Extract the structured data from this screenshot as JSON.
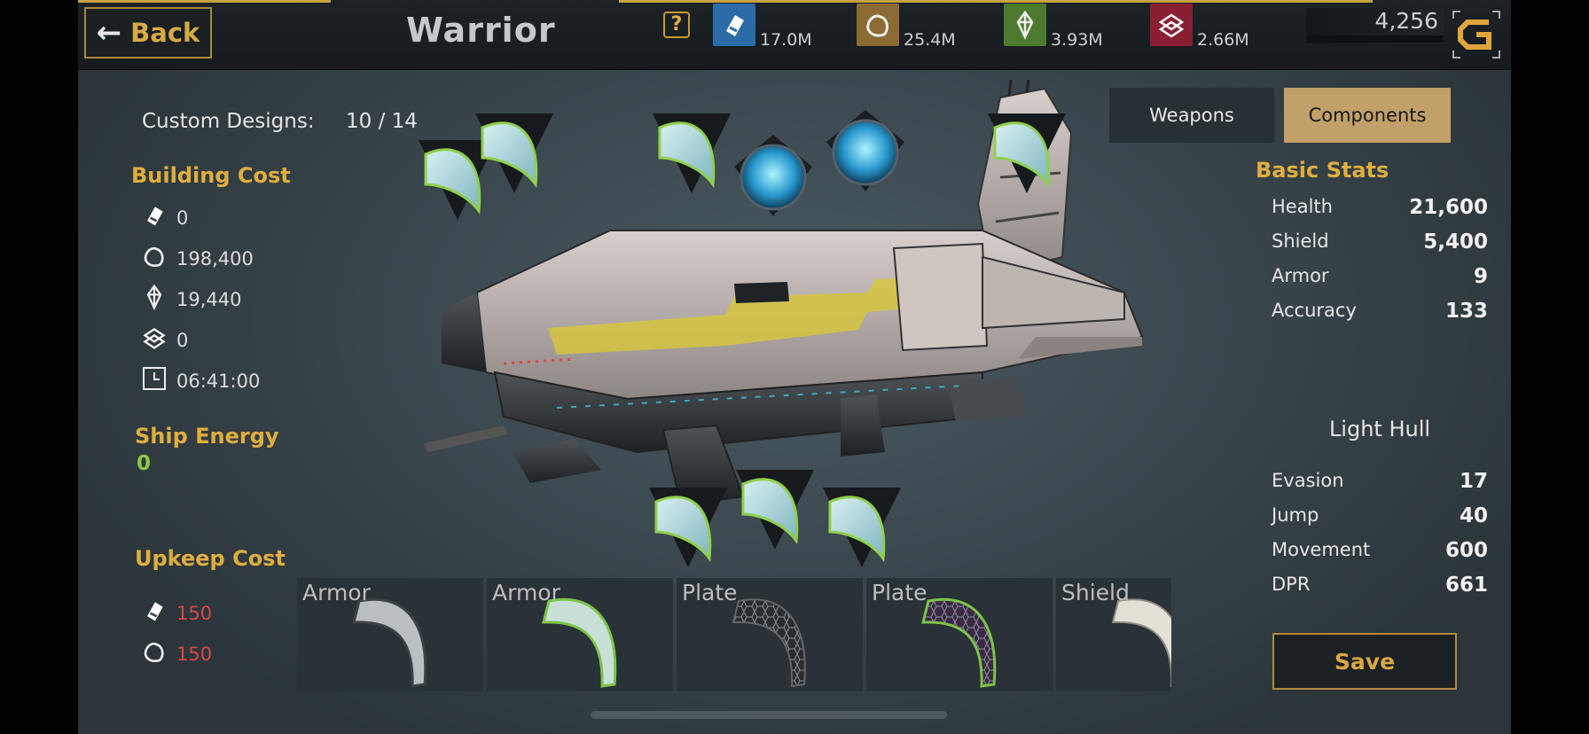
{
  "header": {
    "back_label": "Back",
    "title": "Warrior",
    "help_label": "?",
    "resources": [
      {
        "icon": "credits-icon",
        "value": "17.0M",
        "color": "#2b6ca6"
      },
      {
        "icon": "ore-icon",
        "value": "25.4M",
        "color": "#8b6a34"
      },
      {
        "icon": "crystal-icon",
        "value": "3.93M",
        "color": "#4e7a2f"
      },
      {
        "icon": "alloy-icon",
        "value": "2.66M",
        "color": "#8a1f33"
      }
    ],
    "gold": "4,256"
  },
  "left_panel": {
    "custom_designs_label": "Custom Designs:",
    "custom_designs_value": "10 / 14",
    "building_cost_title": "Building Cost",
    "building_cost": [
      {
        "icon": "credits-icon",
        "value": "0"
      },
      {
        "icon": "ore-icon",
        "value": "198,400"
      },
      {
        "icon": "crystal-icon",
        "value": "19,440"
      },
      {
        "icon": "alloy-icon",
        "value": "0"
      },
      {
        "icon": "clock-icon",
        "value": "06:41:00"
      }
    ],
    "ship_energy_title": "Ship Energy",
    "ship_energy_value": "0",
    "upkeep_cost_title": "Upkeep Cost",
    "upkeep_cost": [
      {
        "icon": "credits-icon",
        "value": "150"
      },
      {
        "icon": "ore-icon",
        "value": "150"
      }
    ]
  },
  "tabs": {
    "weapons": "Weapons",
    "components": "Components",
    "active": "components"
  },
  "stats": {
    "title": "Basic Stats",
    "basic": [
      {
        "label": "Health",
        "value": "21,600"
      },
      {
        "label": "Shield",
        "value": "5,400"
      },
      {
        "label": "Armor",
        "value": "9"
      },
      {
        "label": "Accuracy",
        "value": "133"
      }
    ],
    "hull_name": "Light Hull",
    "hull": [
      {
        "label": "Evasion",
        "value": "17"
      },
      {
        "label": "Jump",
        "value": "40"
      },
      {
        "label": "Movement",
        "value": "600"
      },
      {
        "label": "DPR",
        "value": "661"
      }
    ]
  },
  "save_label": "Save",
  "components_tray": [
    {
      "label": "Armor",
      "variant": "armor-grey"
    },
    {
      "label": "Armor",
      "variant": "armor-green"
    },
    {
      "label": "Plate",
      "variant": "plate-dark"
    },
    {
      "label": "Plate",
      "variant": "plate-purple"
    },
    {
      "label": "Shield",
      "variant": "shield-light"
    }
  ]
}
